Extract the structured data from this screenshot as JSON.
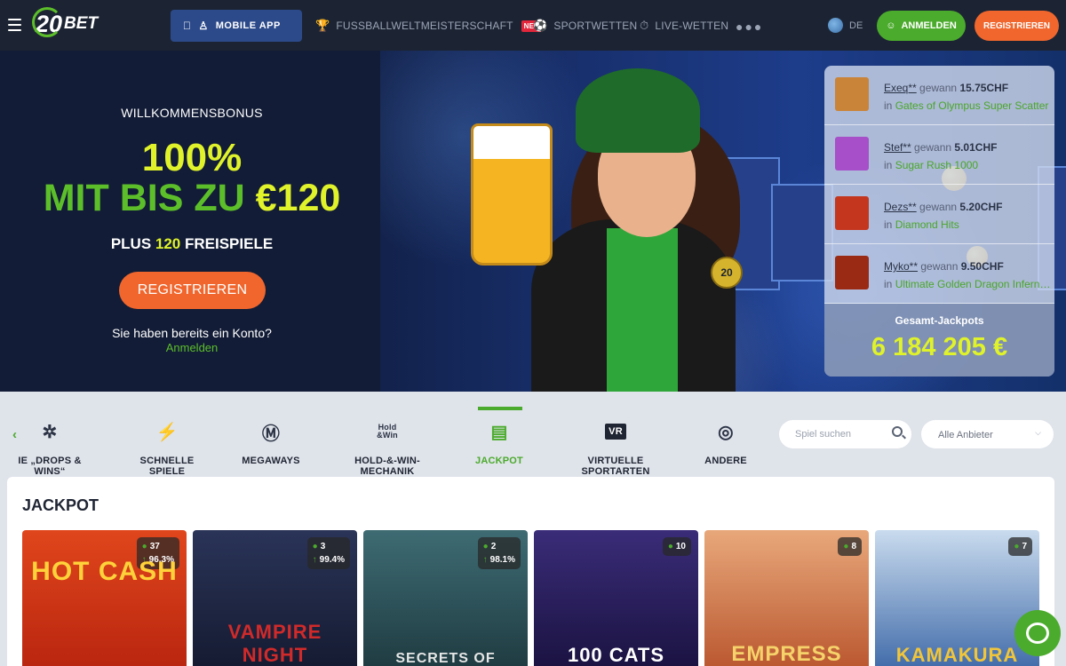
{
  "header": {
    "logo": {
      "number": "20",
      "text": "BET"
    },
    "mobile_app": "MOBILE APP",
    "nav": [
      {
        "label": "FUSSBALLWELTMEISTERSCHAFT",
        "badge": "NEU",
        "icon": "trophy-icon"
      },
      {
        "label": "SPORTWETTEN",
        "icon": "soccer-ball-icon"
      },
      {
        "label": "LIVE-WETTEN",
        "icon": "stopwatch-icon"
      }
    ],
    "language": "DE",
    "login": "ANMELDEN",
    "register": "REGISTRIEREN"
  },
  "hero": {
    "welcome": "WILLKOMMENSBONUS",
    "percent": "100%",
    "upto_text": "MIT BIS ZU",
    "upto_amount": "€120",
    "plus_prefix": "PLUS",
    "plus_num": "120",
    "plus_suffix": "FREISPIELE",
    "register": "REGISTRIEREN",
    "have_account": "Sie haben bereits ein Konto?",
    "signin": "Anmelden"
  },
  "winners": {
    "won_word": "gewann",
    "in_word": "in",
    "items": [
      {
        "user": "Exeq**",
        "amount": "15.75CHF",
        "game": "Gates of Olympus Super Scatter",
        "color": "#c9843a"
      },
      {
        "user": "Stef**",
        "amount": "5.01CHF",
        "game": "Sugar Rush 1000",
        "color": "#a64fc8"
      },
      {
        "user": "Dezs**",
        "amount": "5.20CHF",
        "game": "Diamond Hits",
        "color": "#c4361e"
      },
      {
        "user": "Myko**",
        "amount": "9.50CHF",
        "game": "Ultimate Golden Dragon Infern…",
        "color": "#9b2a14"
      }
    ],
    "jackpot_label": "Gesamt-Jackpots",
    "jackpot_value": "6 184 205 €"
  },
  "categories": [
    {
      "label": "IE „DROPS & WINS“",
      "icon": "drops-wins-icon"
    },
    {
      "label": "SCHNELLE SPIELE",
      "icon": "lightning-icon"
    },
    {
      "label": "MEGAWAYS",
      "icon": "megaways-icon"
    },
    {
      "label": "HOLD-&-WIN-MECHANIK",
      "icon": "hold-win-icon",
      "icon_text": "Hold\n&Win"
    },
    {
      "label": "JACKPOT",
      "icon": "jackpot-icon",
      "active": true
    },
    {
      "label": "VIRTUELLE SPORTARTEN",
      "icon": "vr-icon",
      "icon_text": "VR"
    },
    {
      "label": "ANDERE",
      "icon": "other-icon"
    }
  ],
  "search": {
    "placeholder": "Spiel suchen"
  },
  "provider": {
    "value": "Alle Anbieter"
  },
  "section": {
    "title": "JACKPOT",
    "games": [
      {
        "name": "HOT CASH",
        "players": "37",
        "rtp": "96.3%",
        "color": "#d8421a"
      },
      {
        "name": "VAMPIRE NIGHT",
        "players": "3",
        "rtp": "99.4%",
        "color": "#1c2340"
      },
      {
        "name": "SECRETS OF",
        "players": "2",
        "rtp": "98.1%",
        "color": "#2f4f5a"
      },
      {
        "name": "100 CATS",
        "players": "10",
        "rtp": "",
        "color": "#2a1f5c"
      },
      {
        "name": "EMPRESS",
        "players": "8",
        "rtp": "",
        "color": "#c9683a"
      },
      {
        "name": "KAMAKURA",
        "players": "7",
        "rtp": "",
        "color": "#3a5fa0"
      }
    ]
  }
}
